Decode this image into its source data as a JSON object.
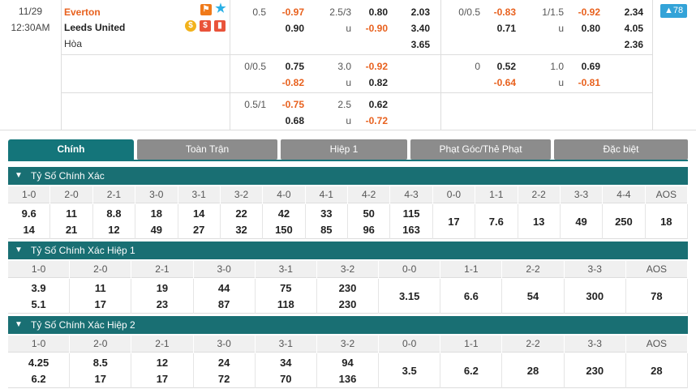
{
  "match": {
    "date": "11/29",
    "time": "12:30AM",
    "home": "Everton",
    "away": "Leeds United",
    "draw": "Hòa",
    "badge": "▲78"
  },
  "odds": {
    "r1": {
      "ah_line": "0.5",
      "ah_home": "-0.97",
      "ah_away": "0.90",
      "ou_line": "2.5/3",
      "ou_over": "0.80",
      "ou_u": "u",
      "ou_under": "-0.90",
      "x_home": "2.03",
      "x_away": "3.40",
      "x_draw": "3.65",
      "h1_ah_line": "0/0.5",
      "h1_ah_home": "-0.83",
      "h1_ah_away": "0.71",
      "h1_ou_line": "1/1.5",
      "h1_ou_over": "-0.92",
      "h1_ou_u": "u",
      "h1_ou_under": "0.80",
      "h1_x_home": "2.34",
      "h1_x_away": "4.05",
      "h1_x_draw": "2.36"
    },
    "r2": {
      "ah_line": "0/0.5",
      "ah_home": "0.75",
      "ah_away": "-0.82",
      "ou_line": "3.0",
      "ou_over": "-0.92",
      "ou_u": "u",
      "ou_under": "0.82",
      "h1_ah_line": "0",
      "h1_ah_home": "0.52",
      "h1_ah_away": "-0.64",
      "h1_ou_line": "1.0",
      "h1_ou_over": "0.69",
      "h1_ou_u": "u",
      "h1_ou_under": "-0.81"
    },
    "r3": {
      "ah_line": "0.5/1",
      "ah_home": "-0.75",
      "ah_away": "0.68",
      "ou_line": "2.5",
      "ou_over": "0.62",
      "ou_u": "u",
      "ou_under": "-0.72"
    }
  },
  "tabs": [
    "Chính",
    "Toàn Trận",
    "Hiệp 1",
    "Phạt Góc/Thẻ Phạt",
    "Đặc biệt"
  ],
  "sections": [
    {
      "title": "Tỷ Số Chính Xác",
      "headers": [
        "1-0",
        "2-0",
        "2-1",
        "3-0",
        "3-1",
        "3-2",
        "4-0",
        "4-1",
        "4-2",
        "4-3",
        "0-0",
        "1-1",
        "2-2",
        "3-3",
        "4-4",
        "AOS"
      ],
      "home": [
        "9.6",
        "11",
        "8.8",
        "18",
        "14",
        "22",
        "42",
        "33",
        "50",
        "115"
      ],
      "away": [
        "14",
        "21",
        "12",
        "49",
        "27",
        "32",
        "150",
        "85",
        "96",
        "163"
      ],
      "single": [
        "17",
        "7.6",
        "13",
        "49",
        "250",
        "18"
      ]
    },
    {
      "title": "Tỷ Số Chính Xác Hiệp 1",
      "headers": [
        "1-0",
        "2-0",
        "2-1",
        "3-0",
        "3-1",
        "3-2",
        "0-0",
        "1-1",
        "2-2",
        "3-3",
        "AOS"
      ],
      "home": [
        "3.9",
        "11",
        "19",
        "44",
        "75",
        "230"
      ],
      "away": [
        "5.1",
        "17",
        "23",
        "87",
        "118",
        "230"
      ],
      "single": [
        "3.15",
        "6.6",
        "54",
        "300",
        "78"
      ]
    },
    {
      "title": "Tỷ Số Chính Xác Hiệp 2",
      "headers": [
        "1-0",
        "2-0",
        "2-1",
        "3-0",
        "3-1",
        "3-2",
        "0-0",
        "1-1",
        "2-2",
        "3-3",
        "AOS"
      ],
      "home": [
        "4.25",
        "8.5",
        "12",
        "24",
        "34",
        "94"
      ],
      "away": [
        "6.2",
        "17",
        "17",
        "72",
        "70",
        "136"
      ],
      "single": [
        "3.5",
        "6.2",
        "28",
        "230",
        "28"
      ]
    }
  ],
  "colors": {
    "accent": "#14757a",
    "negative": "#e8611e",
    "badge": "#33a3d8"
  }
}
